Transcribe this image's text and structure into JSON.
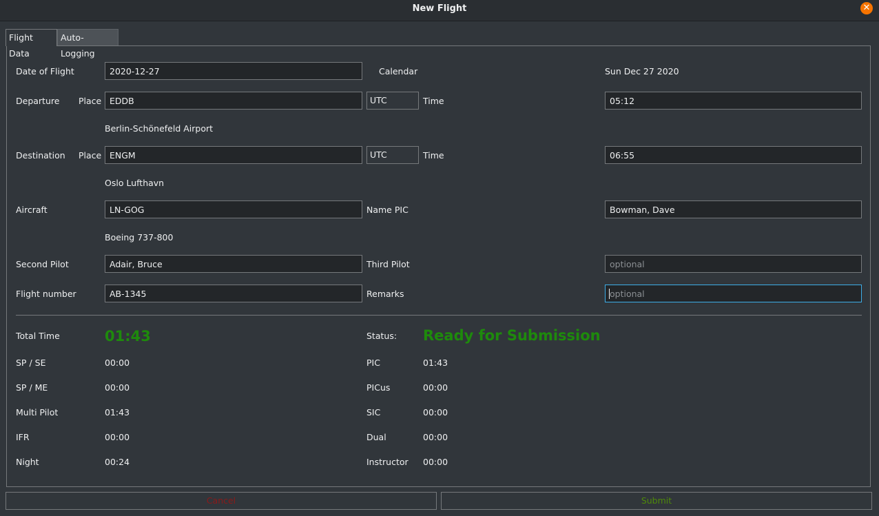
{
  "window": {
    "title": "New Flight"
  },
  "tabs": [
    {
      "label": "Flight Data"
    },
    {
      "label": "Auto-Logging"
    }
  ],
  "form": {
    "date_label": "Date of Flight",
    "date_value": "2020-12-27",
    "calendar_label": "Calendar",
    "calendar_value": "Sun Dec 27 2020",
    "departure_label": "Departure",
    "place_label": "Place",
    "departure_place": "EDDB",
    "utc_label": "UTC",
    "time_label": "Time",
    "departure_time": "05:12",
    "departure_airport_name": "Berlin-Schönefeld Airport",
    "destination_label": "Destination",
    "destination_place": "ENGM",
    "destination_time": "06:55",
    "destination_airport_name": "Oslo Lufthavn",
    "aircraft_label": "Aircraft",
    "aircraft_value": "LN-GOG",
    "aircraft_type": "Boeing 737-800",
    "name_pic_label": "Name PIC",
    "name_pic_value": "Bowman, Dave",
    "second_pilot_label": "Second Pilot",
    "second_pilot_value": "Adair, Bruce",
    "third_pilot_label": "Third Pilot",
    "third_pilot_placeholder": "optional",
    "flight_number_label": "Flight number",
    "flight_number_value": "AB-1345",
    "remarks_label": "Remarks",
    "remarks_placeholder": "optional"
  },
  "summary": {
    "total_time_label": "Total Time",
    "total_time_value": "01:43",
    "status_label": "Status:",
    "status_value": "Ready for Submission",
    "rows_left": [
      {
        "label": "SP / SE",
        "value": "00:00"
      },
      {
        "label": "SP / ME",
        "value": "00:00"
      },
      {
        "label": "Multi Pilot",
        "value": "01:43"
      },
      {
        "label": "IFR",
        "value": "00:00"
      },
      {
        "label": "Night",
        "value": "00:24"
      }
    ],
    "rows_right": [
      {
        "label": "PIC",
        "value": "01:43"
      },
      {
        "label": "PICus",
        "value": "00:00"
      },
      {
        "label": "SIC",
        "value": "00:00"
      },
      {
        "label": "Dual",
        "value": "00:00"
      },
      {
        "label": "Instructor",
        "value": "00:00"
      }
    ]
  },
  "buttons": {
    "cancel": "Cancel",
    "submit": "Submit"
  },
  "colors": {
    "status_green": "#1e8a0c",
    "cancel_red": "#8b1a1a",
    "submit_green": "#4f8a0a",
    "accent": "#3daee9",
    "close": "#f67400"
  },
  "icons": {
    "close": "close-icon"
  }
}
